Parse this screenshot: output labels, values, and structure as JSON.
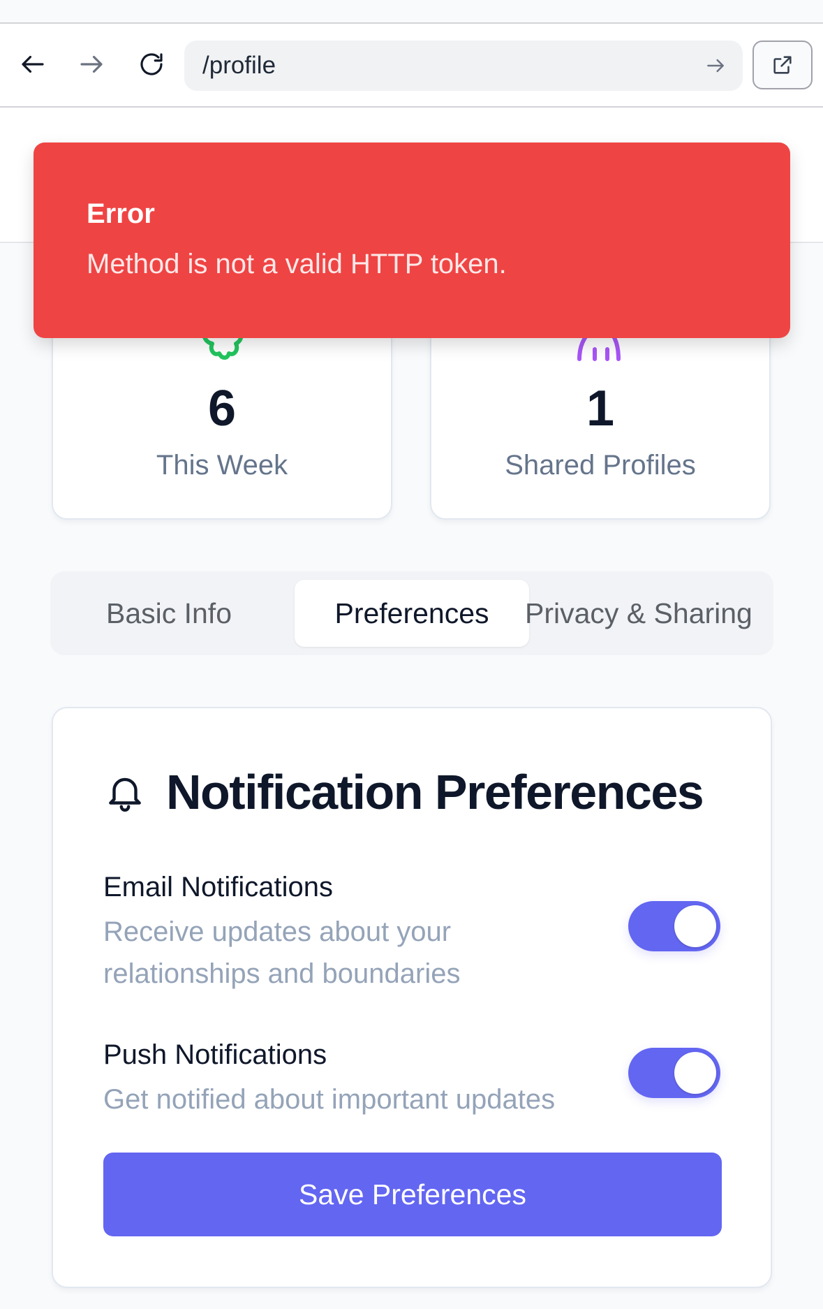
{
  "browser": {
    "url": "/profile"
  },
  "stats": [
    {
      "value": "6",
      "label": "This Week",
      "icon": "award-icon",
      "icon_color": "#22c55e"
    },
    {
      "value": "1",
      "label": "Shared Profiles",
      "icon": "users-icon",
      "icon_color": "#a855f7"
    }
  ],
  "tabs": {
    "basic": "Basic Info",
    "preferences": "Preferences",
    "privacy": "Privacy & Sharing",
    "active": "Preferences"
  },
  "notifications": {
    "title": "Notification Preferences",
    "icon": "bell-icon",
    "email": {
      "title": "Email Notifications",
      "description": "Receive updates about your relationships and boundaries",
      "enabled": true
    },
    "push": {
      "title": "Push Notifications",
      "description": "Get notified about important updates",
      "enabled": true
    },
    "save_label": "Save Preferences"
  },
  "toast": {
    "title": "Error",
    "message": "Method is not a valid HTTP token."
  },
  "colors": {
    "accent": "#6366f1",
    "error": "#ef4444"
  }
}
